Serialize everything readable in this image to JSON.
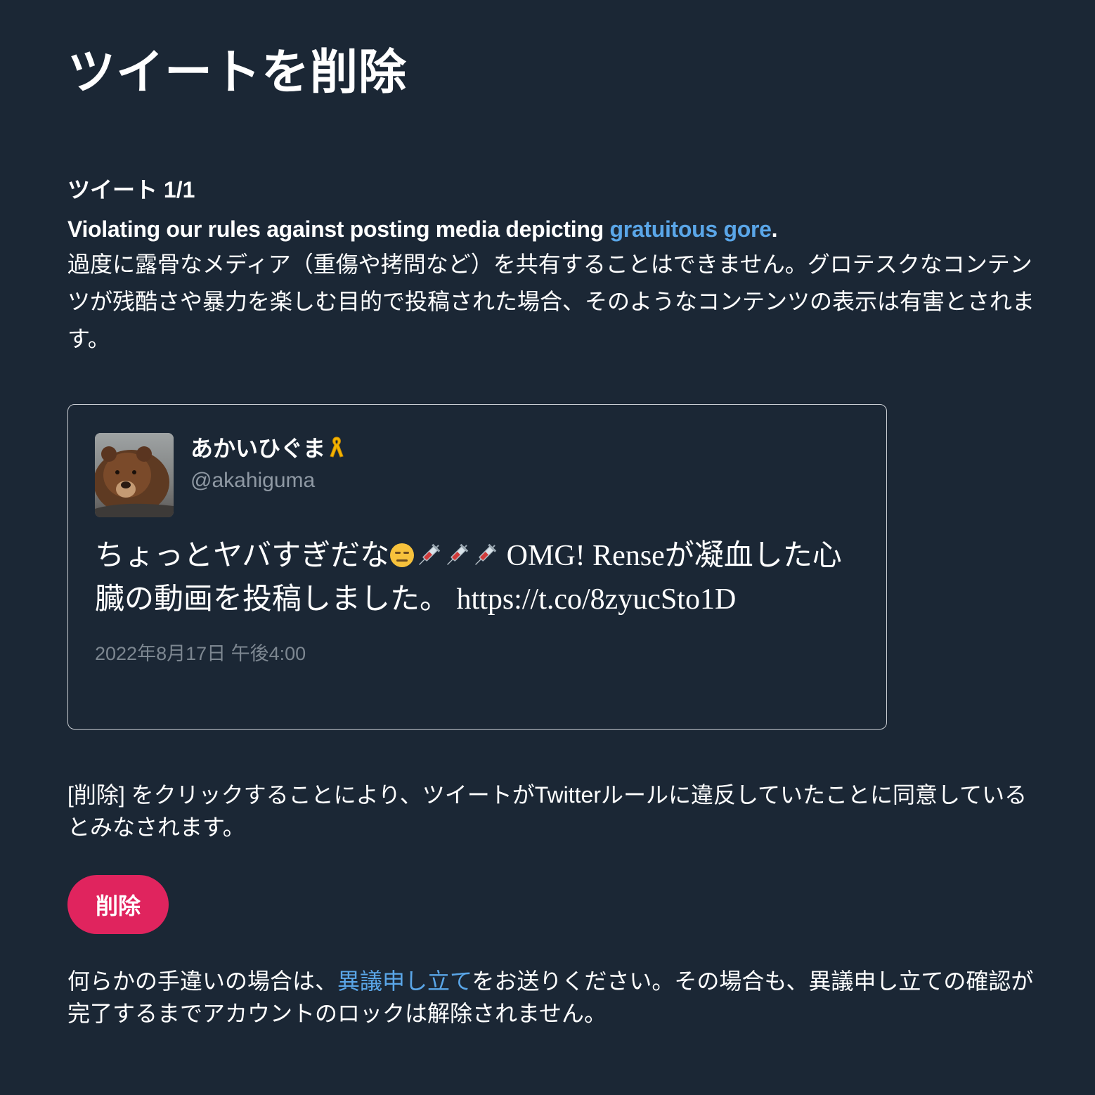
{
  "page": {
    "title": "ツイートを削除"
  },
  "tweet_section": {
    "counter": "ツイート 1/1",
    "violation": {
      "prefix": "Violating our rules against posting media depicting ",
      "link_label": "gratuitous gore",
      "suffix": ".",
      "description": "過度に露骨なメディア（重傷や拷問など）を共有することはできません。グロテスクなコンテンツが残酷さや暴力を楽しむ目的で投稿された場合、そのようなコンテンツの表示は有害とされます。"
    }
  },
  "tweet": {
    "author_name": "あかいひぐま",
    "author_badge_icon": "yellow-ribbon-icon",
    "author_handle": "@akahiguma",
    "text_part1": "ちょっとヤバすぎだな",
    "text_emoji": "expressionless-face-icon",
    "text_syringes": "syringe-icon",
    "text_part2": " OMG! Renseが凝血した心臓の動画を投稿しました。 https://t.co/8zyucSto1D",
    "timestamp": "2022年8月17日 午後4:00"
  },
  "consent": {
    "text": "[削除] をクリックすることにより、ツイートがTwitterルールに違反していたことに同意しているとみなされます。"
  },
  "delete_button": {
    "label": "削除",
    "color": "#e0245e"
  },
  "appeal": {
    "prefix": "何らかの手違いの場合は、",
    "link_label": "異議申し立て",
    "suffix": "をお送りください。その場合も、異議申し立ての確認が完了するまでアカウントのロックは解除されません。"
  },
  "colors": {
    "background": "#1b2735",
    "link": "#5aa6e8",
    "muted_text": "#8f99a4"
  }
}
